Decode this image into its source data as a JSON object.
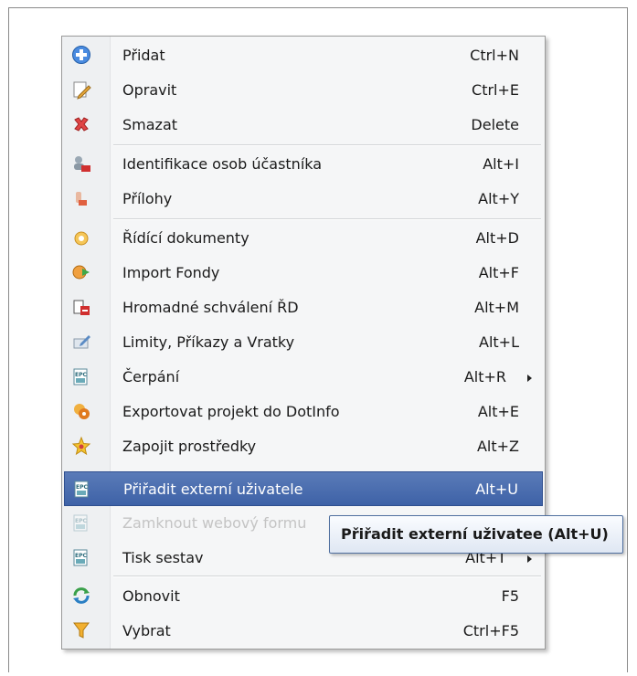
{
  "menu": {
    "items": [
      {
        "label": "Přidat",
        "shortcut": "Ctrl+N",
        "icon": "add-icon",
        "color": "#3b7ed4"
      },
      {
        "label": "Opravit",
        "shortcut": "Ctrl+E",
        "icon": "edit-icon",
        "color": "#e3a33a"
      },
      {
        "label": "Smazat",
        "shortcut": "Delete",
        "icon": "delete-icon",
        "color": "#d93a3a"
      },
      {
        "label": "Identifikace osob účastníka",
        "shortcut": "Alt+I",
        "icon": "persons-pdf-icon",
        "color": "#c43b3b"
      },
      {
        "label": "Přílohy",
        "shortcut": "Alt+Y",
        "icon": "attachments-icon",
        "color": "#d85a3a"
      },
      {
        "label": "Řídící dokumenty",
        "shortcut": "Alt+D",
        "icon": "documents-icon",
        "color": "#e6a93a"
      },
      {
        "label": "Import Fondy",
        "shortcut": "Alt+F",
        "icon": "import-icon",
        "color": "#4aa84a"
      },
      {
        "label": "Hromadné schválení ŘD",
        "shortcut": "Alt+M",
        "icon": "bulk-approve-icon",
        "color": "#c83030"
      },
      {
        "label": "Limity, Příkazy a Vratky",
        "shortcut": "Alt+L",
        "icon": "limits-icon",
        "color": "#5b8bc4"
      },
      {
        "label": "Čerpání",
        "shortcut": "Alt+R",
        "icon": "drawing-icon",
        "color": "#3a8a9a"
      },
      {
        "label": "Exportovat projekt do DotInfo",
        "shortcut": "Alt+E",
        "icon": "export-icon",
        "color": "#e69a2a"
      },
      {
        "label": "Zapojit prostředky",
        "shortcut": "Alt+Z",
        "icon": "star-icon",
        "color": "#e8b020"
      },
      {
        "label": "Přiřadit externí uživatele",
        "shortcut": "Alt+U",
        "icon": "assign-users-icon",
        "color": "#3a8a9a"
      },
      {
        "label": "Zamknout webový formu",
        "shortcut": "",
        "icon": "lock-form-icon",
        "color": "#3a8a9a"
      },
      {
        "label": "Tisk sestav",
        "shortcut": "Alt+T",
        "icon": "print-reports-icon",
        "color": "#3a8a9a"
      },
      {
        "label": "Obnovit",
        "shortcut": "F5",
        "icon": "refresh-icon",
        "color": "#3aa04a"
      },
      {
        "label": "Vybrat",
        "shortcut": "Ctrl+F5",
        "icon": "filter-icon",
        "color": "#e8a020"
      }
    ]
  },
  "tooltip": {
    "text": "Přiřadit externí uživatee (Alt+U)"
  }
}
